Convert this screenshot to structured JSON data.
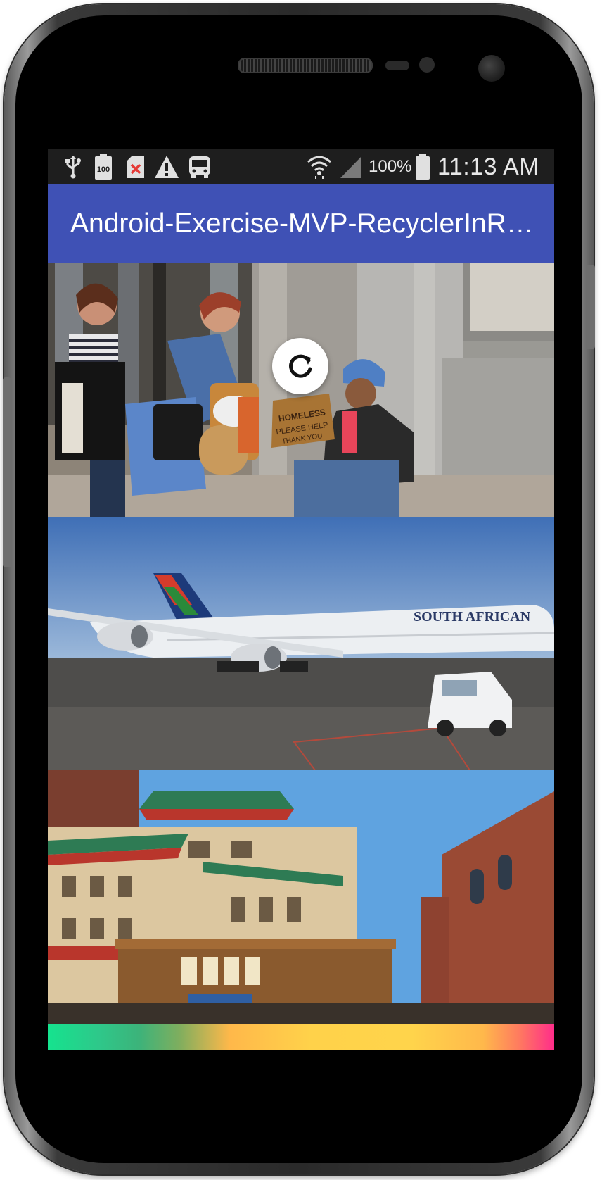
{
  "status_bar": {
    "icons": [
      "usb-icon",
      "battery-100-icon",
      "sd-card-error-icon",
      "warning-icon",
      "bus-icon",
      "wifi-icon",
      "signal-icon",
      "battery-icon"
    ],
    "battery_level_label": "100",
    "battery_percent": "100%",
    "time": "11:13 AM"
  },
  "app_bar": {
    "title": "Android-Exercise-MVP-RecyclerInR…",
    "color": "#3f51b5"
  },
  "list": {
    "items": [
      {
        "image": "street-scene-photo",
        "sign_text": "HOMELESS PLEASE HELP THANK YOU"
      },
      {
        "image": "airplane-photo",
        "livery_text": "SOUTH AFRICAN"
      },
      {
        "image": "chinatown-cable-car-photo"
      }
    ]
  },
  "refresh_indicator": {
    "icon": "refresh-icon"
  }
}
